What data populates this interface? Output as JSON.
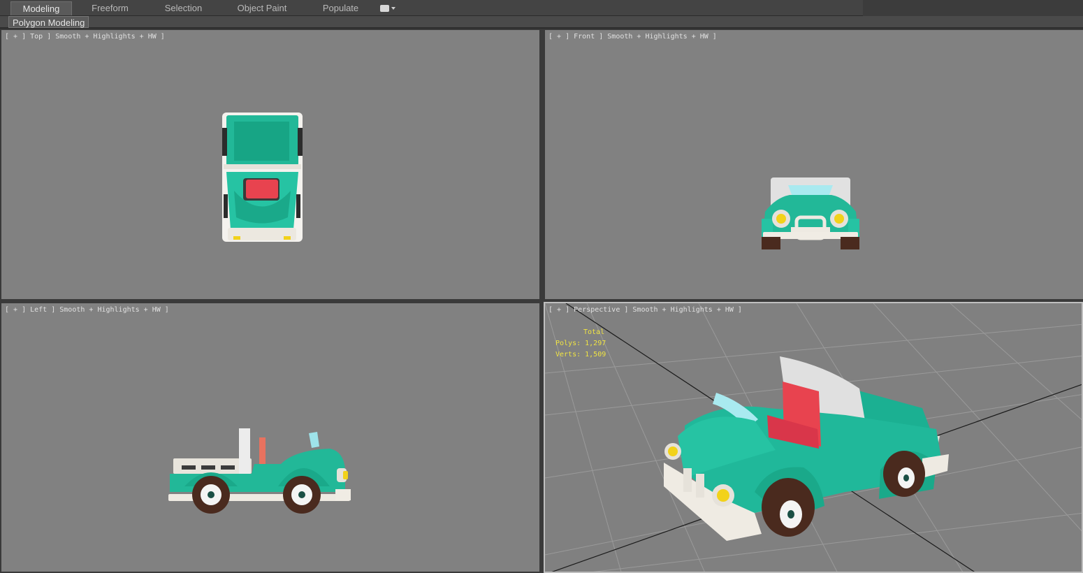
{
  "ribbon": {
    "tabs": [
      {
        "label": "Modeling",
        "active": true
      },
      {
        "label": "Freeform",
        "active": false
      },
      {
        "label": "Selection",
        "active": false
      },
      {
        "label": "Object Paint",
        "active": false
      },
      {
        "label": "Populate",
        "active": false
      }
    ],
    "extra_icon": "dropdown-toggle-icon",
    "panel_label": "Polygon Modeling"
  },
  "viewports": {
    "top": {
      "label": "[ + ] Top ] Smooth + Highlights + HW ]"
    },
    "front": {
      "label": "[ + ] Front ] Smooth + Highlights + HW ]"
    },
    "left": {
      "label": "[ + ] Left ] Smooth + Highlights + HW ]"
    },
    "perspective": {
      "label": "[ + ] Perspective ] Smooth + Highlights + HW ]",
      "stats": {
        "total": "Total",
        "polys": "Polys: 1,297",
        "verts": "Verts: 1,509"
      }
    }
  },
  "colors": {
    "viewport_bg": "#818181",
    "car_body": "#20b89a",
    "car_trim": "#e6e2da",
    "seat": "#e8434f",
    "tire": "#4a2a1e",
    "headlight": "#f2d21a",
    "stats_text": "#f0e442"
  }
}
